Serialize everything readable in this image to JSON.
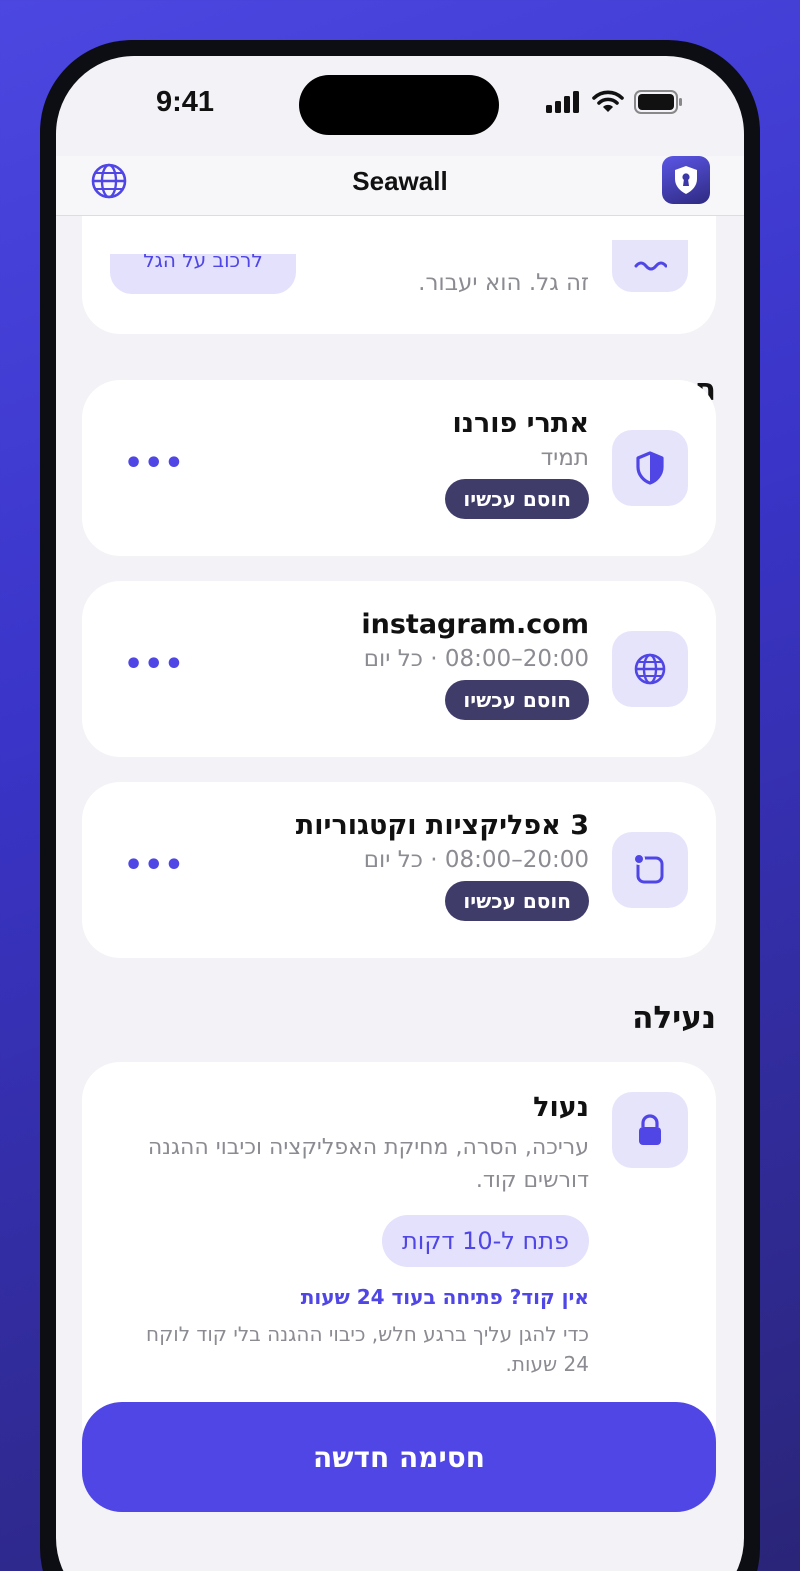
{
  "status": {
    "time": "9:41"
  },
  "nav": {
    "title": "Seawall",
    "globe_icon": "globe-icon",
    "lock_icon": "keyhole-shield-icon"
  },
  "top_card": {
    "text": "זה גל. הוא יעבור.",
    "button_partial": "לרכוב על הגל"
  },
  "blocks": {
    "section_title": "חסימות",
    "items": [
      {
        "title": "אתרי פורנו",
        "subtitle": "תמיד",
        "status": "חוסם עכשיו",
        "more": "•••",
        "icon": "shield-icon"
      },
      {
        "title": "instagram.com",
        "subtitle": "20:00–08:00 · כל יום",
        "status": "חוסם עכשיו",
        "more": "•••",
        "icon": "globe-icon"
      },
      {
        "title": "3 אפליקציות וקטגוריות",
        "subtitle": "20:00–08:00 · כל יום",
        "status": "חוסם עכשיו",
        "more": "•••",
        "icon": "app-icon"
      }
    ]
  },
  "lock": {
    "section_title": "נעילה",
    "title": "נעול",
    "description": "עריכה, הסרה, מחיקת האפליקציה וכיבוי ההגנה דורשים קוד.",
    "open_button": "פתח ל-10 דקות",
    "no_code_link": "אין קוד? פתיחה בעוד 24 שעות",
    "note": "כדי להגן עליך ברגע חלש, כיבוי ההגנה בלי קוד לוקח 24 שעות.",
    "icon": "lock-icon"
  },
  "new_block_button": "חסימה חדשה",
  "colors": {
    "accent": "#4f46e5",
    "pill_dark": "#3f3c6a",
    "tile_bg": "#e6e4fb"
  }
}
